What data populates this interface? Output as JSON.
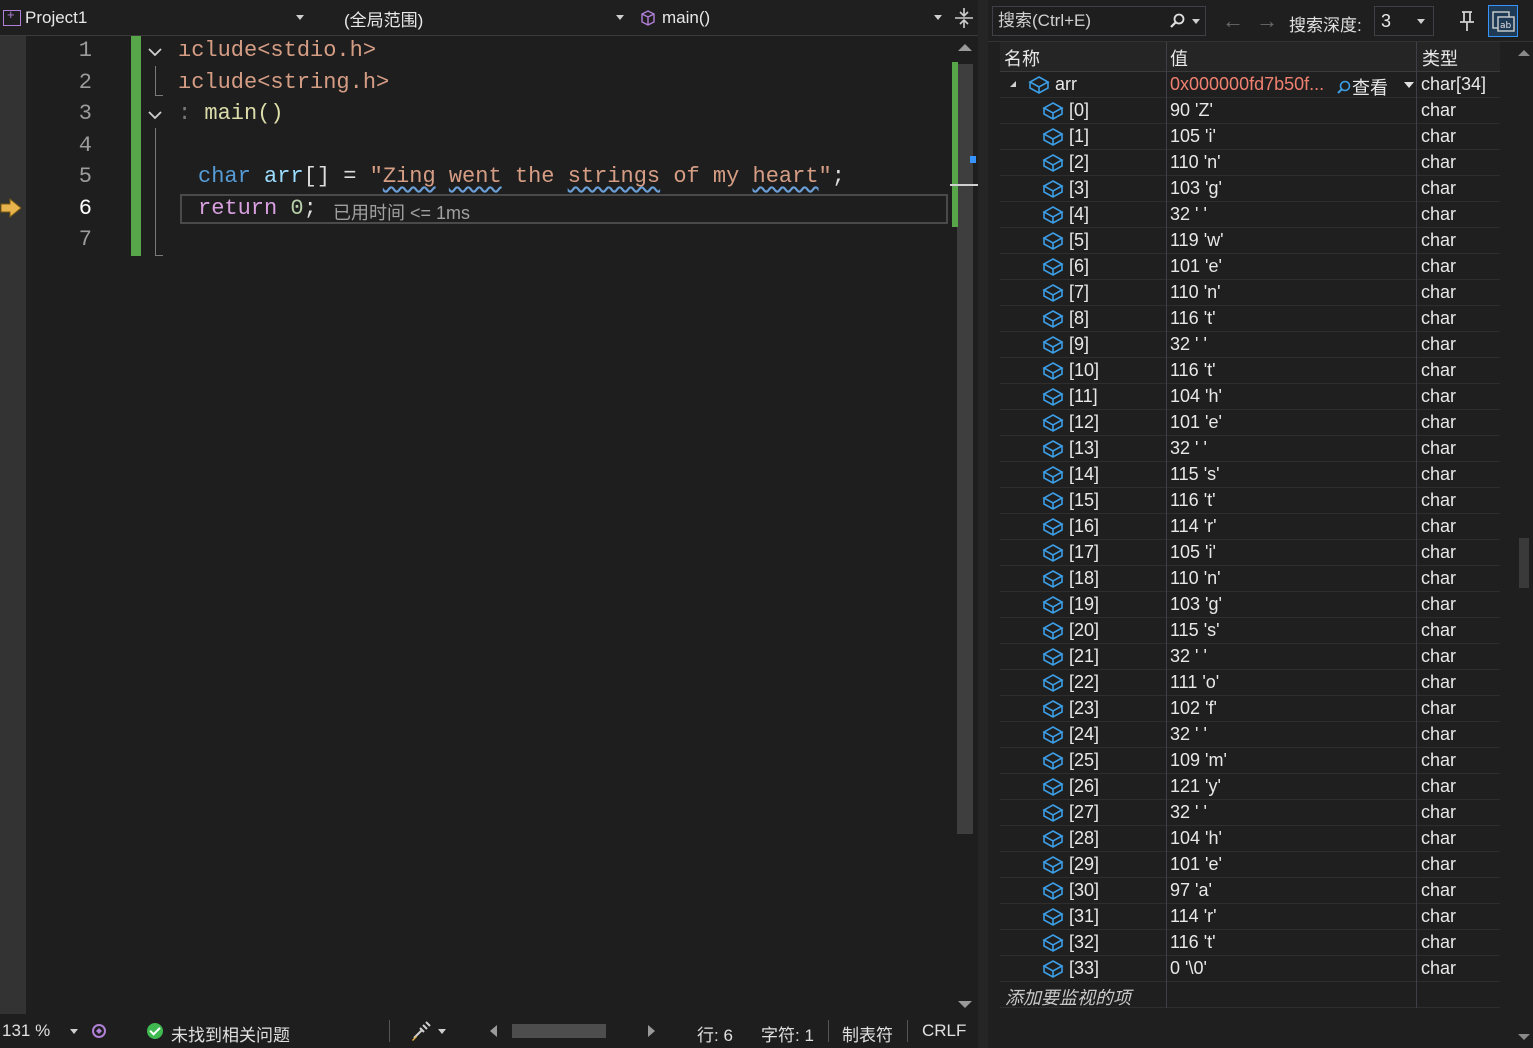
{
  "editor": {
    "nav": {
      "project": "Project1",
      "scope": "(全局范围)",
      "function": "main()"
    },
    "lines": [
      {
        "num": "1",
        "current": false
      },
      {
        "num": "2",
        "current": false
      },
      {
        "num": "3",
        "current": false
      },
      {
        "num": "4",
        "current": false
      },
      {
        "num": "5",
        "current": false
      },
      {
        "num": "6",
        "current": true
      },
      {
        "num": "7",
        "current": false
      }
    ],
    "code": {
      "line1": "ıclude<stdio.h>",
      "line2": "ıclude<string.h>",
      "line3_prefix": ": ",
      "line3_fn": "main()",
      "line5_type": "char",
      "line5_var": "arr",
      "line5_brackets": "[]",
      "line5_eq": " = ",
      "line5_q1": "\"",
      "line5_w1": "Zing",
      "line5_w2": "went",
      "line5_w3": "the",
      "line5_w4": "strings",
      "line5_w5": "of",
      "line5_w6": "my",
      "line5_w7": "heart",
      "line5_q2": "\"",
      "line5_end": ";",
      "line6_kw": "return",
      "line6_num": "0",
      "line6_end": ";",
      "perf_tip": "已用时间 <= 1ms"
    },
    "status": {
      "zoom": "131 %",
      "issues": "未找到相关问题",
      "line": "行: 6",
      "char": "字符: 1",
      "tabs": "制表符",
      "eol": "CRLF"
    }
  },
  "watch": {
    "toolbar": {
      "search_placeholder": "搜索(Ctrl+E)",
      "depth_label": "搜索深度:",
      "depth_value": "3"
    },
    "columns": {
      "name": "名称",
      "value": "值",
      "type": "类型"
    },
    "parent": {
      "name": "arr",
      "value": "0x000000fd7b50f...",
      "viz_label": "查看",
      "type": "char[34]"
    },
    "items": [
      {
        "name": "[0]",
        "value": "90 'Z'",
        "type": "char"
      },
      {
        "name": "[1]",
        "value": "105 'i'",
        "type": "char"
      },
      {
        "name": "[2]",
        "value": "110 'n'",
        "type": "char"
      },
      {
        "name": "[3]",
        "value": "103 'g'",
        "type": "char"
      },
      {
        "name": "[4]",
        "value": "32 ' '",
        "type": "char"
      },
      {
        "name": "[5]",
        "value": "119 'w'",
        "type": "char"
      },
      {
        "name": "[6]",
        "value": "101 'e'",
        "type": "char"
      },
      {
        "name": "[7]",
        "value": "110 'n'",
        "type": "char"
      },
      {
        "name": "[8]",
        "value": "116 't'",
        "type": "char"
      },
      {
        "name": "[9]",
        "value": "32 ' '",
        "type": "char"
      },
      {
        "name": "[10]",
        "value": "116 't'",
        "type": "char"
      },
      {
        "name": "[11]",
        "value": "104 'h'",
        "type": "char"
      },
      {
        "name": "[12]",
        "value": "101 'e'",
        "type": "char"
      },
      {
        "name": "[13]",
        "value": "32 ' '",
        "type": "char"
      },
      {
        "name": "[14]",
        "value": "115 's'",
        "type": "char"
      },
      {
        "name": "[15]",
        "value": "116 't'",
        "type": "char"
      },
      {
        "name": "[16]",
        "value": "114 'r'",
        "type": "char"
      },
      {
        "name": "[17]",
        "value": "105 'i'",
        "type": "char"
      },
      {
        "name": "[18]",
        "value": "110 'n'",
        "type": "char"
      },
      {
        "name": "[19]",
        "value": "103 'g'",
        "type": "char"
      },
      {
        "name": "[20]",
        "value": "115 's'",
        "type": "char"
      },
      {
        "name": "[21]",
        "value": "32 ' '",
        "type": "char"
      },
      {
        "name": "[22]",
        "value": "111 'o'",
        "type": "char"
      },
      {
        "name": "[23]",
        "value": "102 'f'",
        "type": "char"
      },
      {
        "name": "[24]",
        "value": "32 ' '",
        "type": "char"
      },
      {
        "name": "[25]",
        "value": "109 'm'",
        "type": "char"
      },
      {
        "name": "[26]",
        "value": "121 'y'",
        "type": "char"
      },
      {
        "name": "[27]",
        "value": "32 ' '",
        "type": "char"
      },
      {
        "name": "[28]",
        "value": "104 'h'",
        "type": "char"
      },
      {
        "name": "[29]",
        "value": "101 'e'",
        "type": "char"
      },
      {
        "name": "[30]",
        "value": "97 'a'",
        "type": "char"
      },
      {
        "name": "[31]",
        "value": "114 'r'",
        "type": "char"
      },
      {
        "name": "[32]",
        "value": "116 't'",
        "type": "char"
      },
      {
        "name": "[33]",
        "value": "0 '\\0'",
        "type": "char"
      }
    ],
    "add_item_label": "添加要监视的项"
  }
}
